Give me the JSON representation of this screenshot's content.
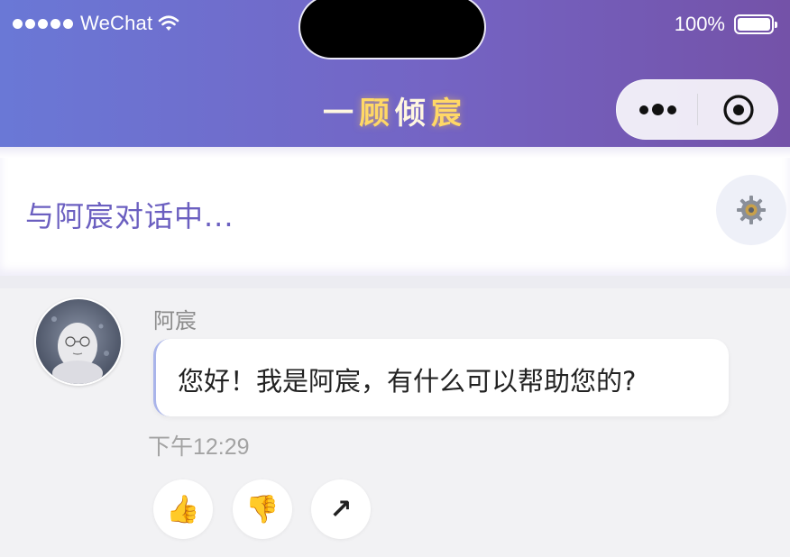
{
  "status_bar": {
    "carrier": "WeChat",
    "battery": "100%",
    "icons": [
      "signal-dots-icon",
      "wifi-icon",
      "battery-icon"
    ]
  },
  "nav": {
    "title_parts": [
      "一",
      "顾",
      "倾",
      "宸"
    ],
    "capsule_icons": [
      "more-dots-icon",
      "close-target-icon"
    ]
  },
  "chat_status": {
    "text": "与阿宸对话中...",
    "settings_icon": "gear-icon"
  },
  "message": {
    "sender": "阿宸",
    "text": "您好！我是阿宸，有什么可以帮助您的?",
    "time": "下午12:29",
    "actions": [
      {
        "icon": "thumbs-up-icon",
        "glyph": "👍"
      },
      {
        "icon": "thumbs-down-icon",
        "glyph": "👎"
      },
      {
        "icon": "share-arrow-icon",
        "glyph": "↗"
      }
    ]
  },
  "colors": {
    "header_gradient_start": "#6a78d6",
    "header_gradient_end": "#7452a8",
    "title_gold": "#ffd866",
    "chat_status_text": "#6b5fc0",
    "bubble_accent": "#a9b4ea",
    "background": "#f2f2f4"
  }
}
